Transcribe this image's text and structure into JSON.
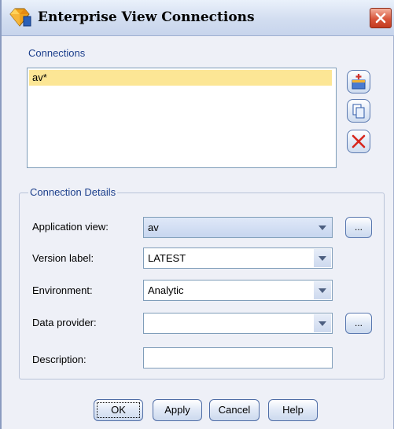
{
  "window": {
    "title": "Enterprise View Connections",
    "icon": "diamond-app-icon"
  },
  "connections": {
    "group_label": "Connections",
    "items": [
      "av*"
    ],
    "selected_index": 0,
    "side_buttons": [
      {
        "name": "add-connection-button",
        "icon": "add-connection-icon"
      },
      {
        "name": "copy-connection-button",
        "icon": "copy-icon"
      },
      {
        "name": "delete-connection-button",
        "icon": "delete-x-icon"
      }
    ]
  },
  "details": {
    "group_label": "Connection Details",
    "application_view": {
      "label": "Application view:",
      "value": "av",
      "button": "..."
    },
    "version_label": {
      "label": "Version label:",
      "value": "LATEST"
    },
    "environment": {
      "label": "Environment:",
      "value": "Analytic"
    },
    "data_provider": {
      "label": "Data provider:",
      "value": "",
      "button": "..."
    },
    "description": {
      "label": "Description:",
      "value": ""
    }
  },
  "buttons": {
    "ok": "OK",
    "apply": "Apply",
    "cancel": "Cancel",
    "help": "Help"
  },
  "colors": {
    "selection": "#fce695",
    "group_label": "#1c3f8c",
    "dialog_bg": "#eef0f7"
  }
}
